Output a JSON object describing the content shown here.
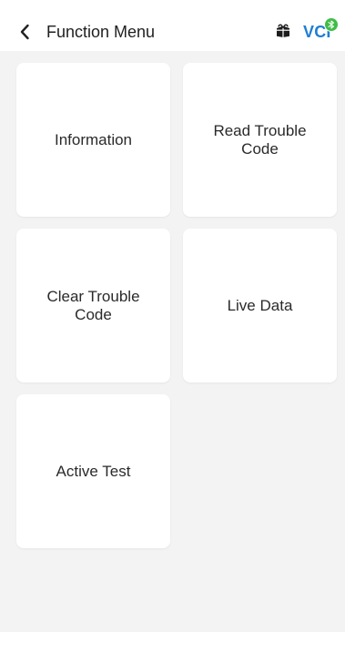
{
  "header": {
    "back_icon": "chevron-left-icon",
    "title": "Function Menu",
    "gift_icon": "gift-icon",
    "vci_label": "VCI",
    "vci_badge_icon": "bluetooth-icon",
    "accent_color": "#1e7ed5",
    "badge_color": "#3fbe45"
  },
  "menu": {
    "items": [
      {
        "label": "Information"
      },
      {
        "label": "Read Trouble\nCode"
      },
      {
        "label": "Clear Trouble\nCode"
      },
      {
        "label": "Live Data"
      },
      {
        "label": "Active Test"
      }
    ]
  },
  "colors": {
    "page_background": "#f3f3f3",
    "card_background": "#ffffff",
    "text": "#2a2a2a"
  }
}
